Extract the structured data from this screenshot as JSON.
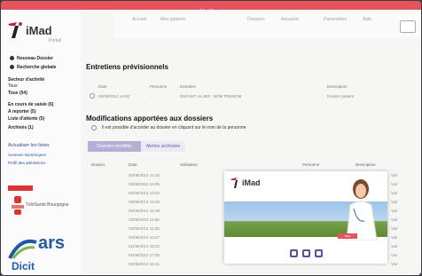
{
  "window": {
    "title": "iMad Portail"
  },
  "brand": {
    "name": "iMad",
    "subtitle": "Portail"
  },
  "topnav": {
    "items": [
      "Accueil",
      "Mes patients",
      "Dossiers",
      "Annuaire",
      "Paramètres",
      "Aide"
    ]
  },
  "sidebar": {
    "nouveau_dossier": "Nouveau Dossier",
    "recherche_globale": "Recherche globale",
    "section_label": "Secteur d'activité",
    "field_label": "Tous",
    "item_tous": "Tous (54)",
    "item_en_cours": "En cours de saisie (6)",
    "item_a_reporter": "A reporter (5)",
    "item_liste_attente": "Liste d'attente (5)",
    "item_archives": "Archivés (1)",
    "link_actualiser": "Actualiser les listes",
    "link_annexes": "Annexes Numériques",
    "link_profil": "Profil des admissions",
    "partner1": "TéléSanté Bourgogne"
  },
  "partners": {
    "ars": "ars",
    "dicit": "Dicit"
  },
  "main": {
    "section1_title": "Entretiens prévisionnels",
    "section1_cols": [
      "Date",
      "Personne",
      "Entretien",
      "Description"
    ],
    "section1_row": [
      "02/09/2014 14:00",
      "-",
      "ENFANT ALLIER : NOM  PRENOM",
      "Dossier patient"
    ],
    "section2_title": "Modifications apportées aux dossiers",
    "info": "Il est possible d'accéder au dossier en cliquant sur le nom de la personne",
    "tab_active": "Dossiers modifiés",
    "tab_inactive": "Alertes archivées",
    "grid_cols": [
      "Dossier",
      "Date",
      "Utilisateur",
      "Personne",
      "Description"
    ],
    "grid_rows": [
      [
        "02/09/2014 14:10",
        "Voir"
      ],
      [
        "02/09/2014 14:05",
        "Voir"
      ],
      [
        "02/09/2014 13:52",
        "Voir"
      ],
      [
        "02/09/2014 13:40",
        "Voir"
      ],
      [
        "02/09/2014 12:18",
        "Voir"
      ],
      [
        "02/09/2014 11:56",
        "Voir"
      ],
      [
        "02/09/2014 11:30",
        "Voir"
      ],
      [
        "02/09/2014 10:47",
        "Voir"
      ],
      [
        "01/09/2014 18:22",
        "Voir"
      ],
      [
        "01/09/2014 17:05",
        "Voir"
      ],
      [
        "01/09/2014 16:41",
        "Voir"
      ]
    ]
  },
  "popup": {
    "brand": "iMad",
    "badge": "iMad"
  },
  "colors": {
    "accent": "#e4545e",
    "brand_blue": "#1f5aa6",
    "tab_purple": "#b7aed8"
  }
}
